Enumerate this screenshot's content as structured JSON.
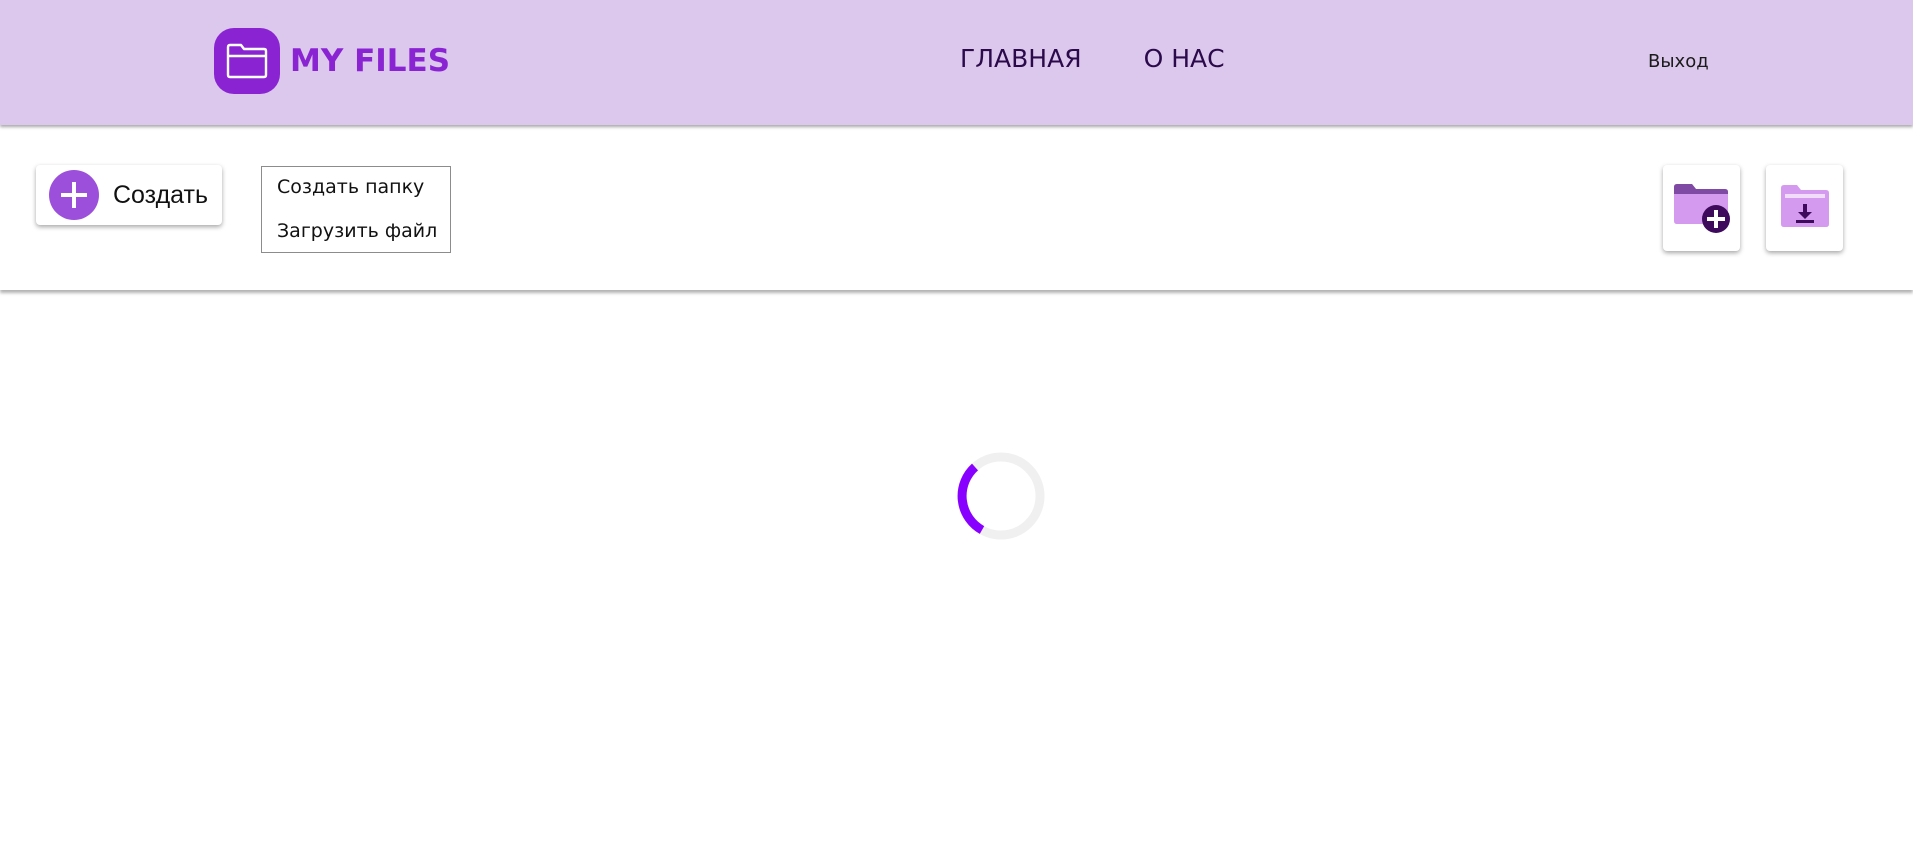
{
  "header": {
    "logo_text": "MY FILES",
    "logo_icon": "folder-icon",
    "nav": [
      {
        "label": "ГЛАВНАЯ"
      },
      {
        "label": "О НАС"
      }
    ],
    "logout_label": "Выход"
  },
  "toolbar": {
    "create_label": "Создать",
    "create_icon": "plus-icon",
    "menu_items": [
      {
        "label": "Создать папку"
      },
      {
        "label": "Загрузить файл"
      }
    ],
    "icon_buttons": [
      {
        "icon": "folder-add-icon"
      },
      {
        "icon": "folder-download-icon"
      }
    ]
  },
  "main": {
    "loading": true,
    "spinner_icon": "loading-spinner"
  },
  "colors": {
    "header_bg": "#dcc7ed",
    "brand": "#8a24d3",
    "accent": "#9b4fdb",
    "spinner": "#8800ff"
  }
}
